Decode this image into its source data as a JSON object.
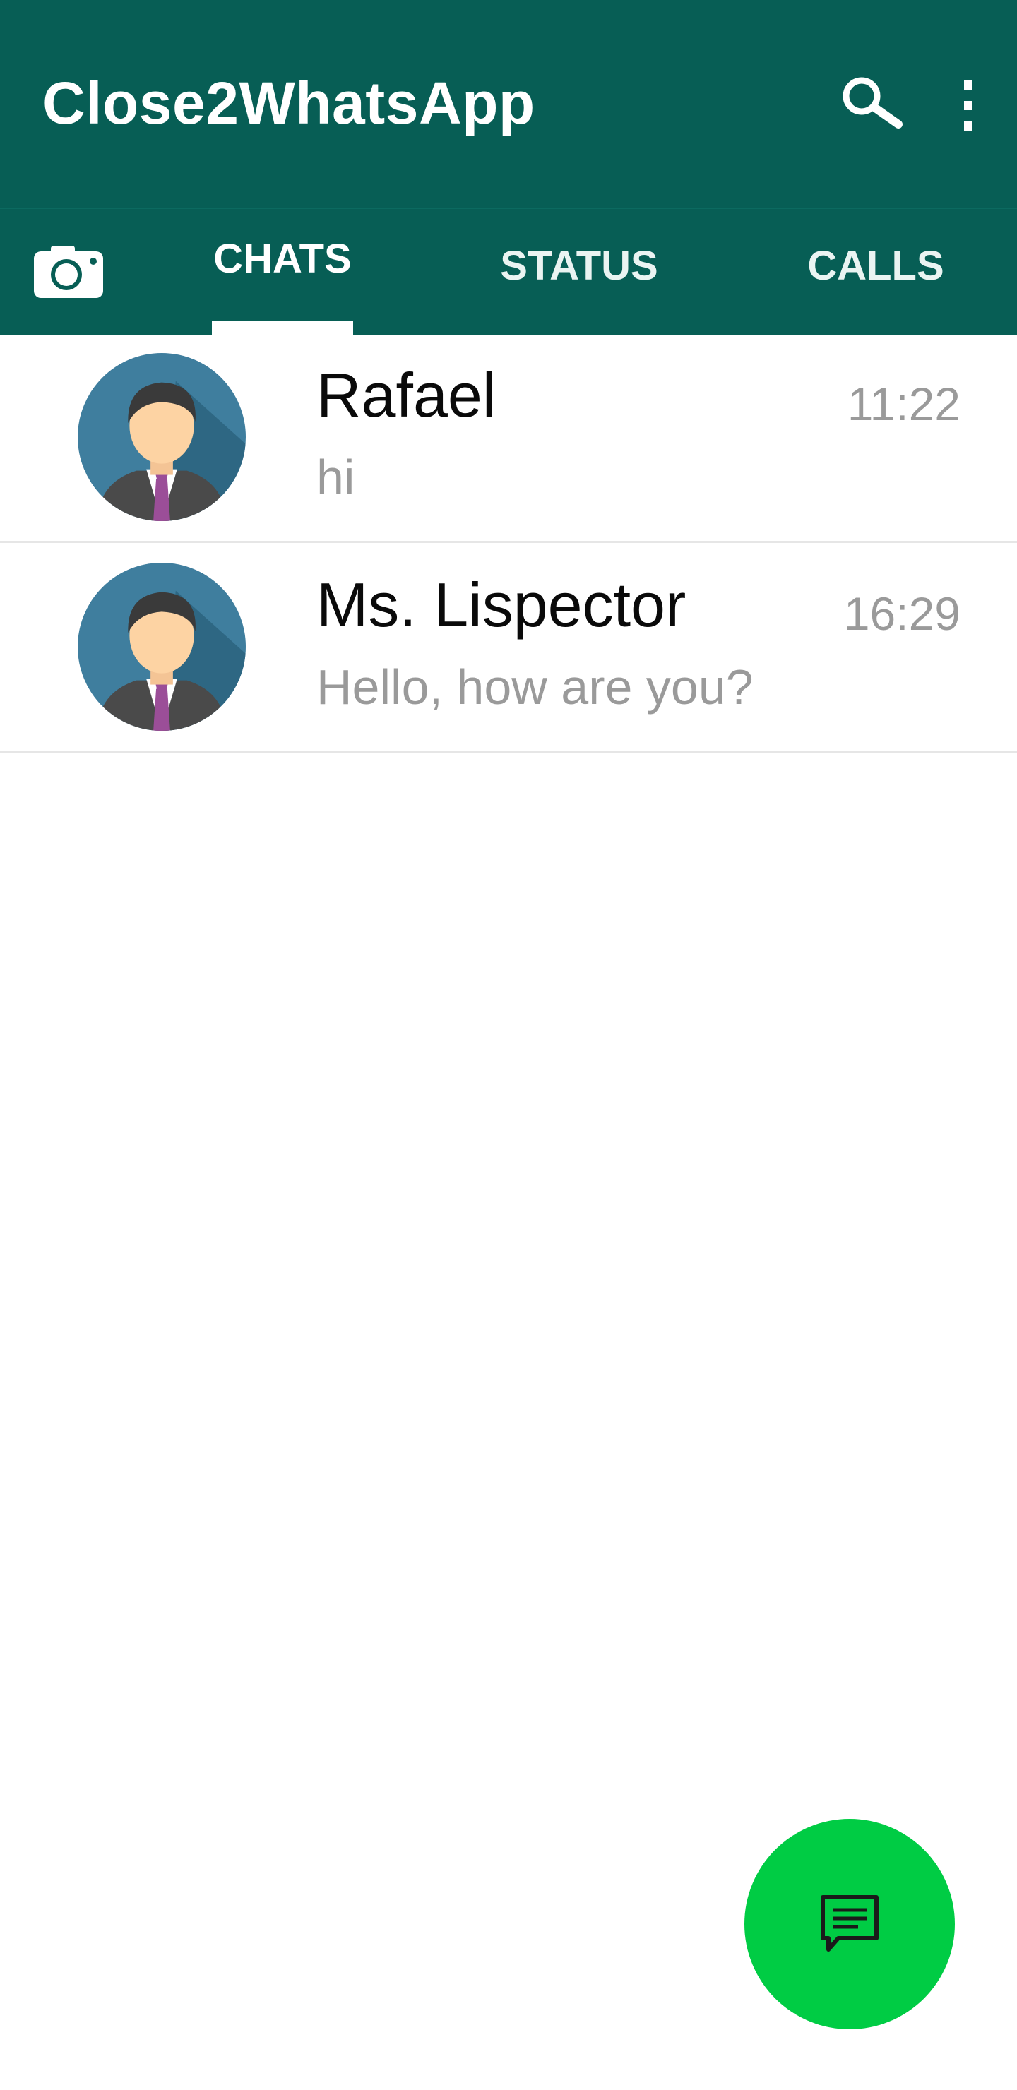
{
  "app": {
    "title": "Close2WhatsApp"
  },
  "appbar_icons": {
    "search": "search-icon",
    "more": "more-vert-icon"
  },
  "tabs": [
    {
      "label": "CHATS",
      "selected": true
    },
    {
      "label": "STATUS",
      "selected": false
    },
    {
      "label": "CALLS",
      "selected": false
    }
  ],
  "chats": [
    {
      "name": "Rafael",
      "time": "11:22",
      "message": "hi",
      "avatar": "person-avatar-icon"
    },
    {
      "name": "Ms. Lispector",
      "time": "16:29",
      "message": "Hello, how are you?",
      "avatar": "person-avatar-icon"
    }
  ],
  "fab": {
    "icon": "new-chat-icon"
  },
  "colors": {
    "primary": "#075e55",
    "accent": "#00cc44",
    "secondary_text": "#9a9a9a"
  }
}
